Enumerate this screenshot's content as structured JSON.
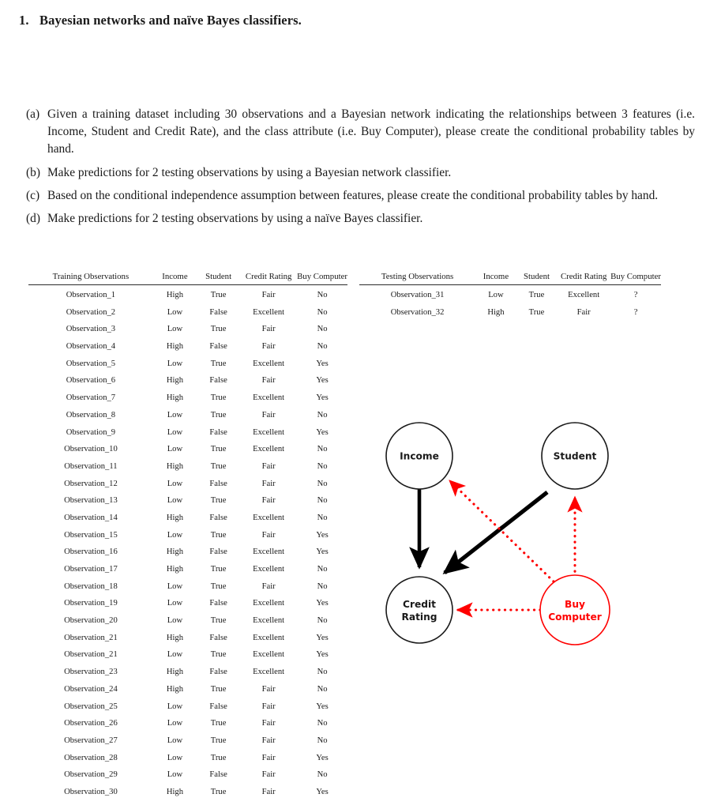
{
  "heading": {
    "number": "1.",
    "text": "Bayesian networks and naïve Bayes classifiers."
  },
  "subquestions": [
    {
      "label": "(a)",
      "text": "Given a training dataset including 30 observations and a Bayesian network indicating the relationships between 3 features (i.e. Income, Student and Credit Rate), and the class attribute (i.e. Buy Computer), please create the conditional probability tables by hand."
    },
    {
      "label": "(b)",
      "text": "Make predictions for 2 testing observations by using a Bayesian network classifier."
    },
    {
      "label": "(c)",
      "text": "Based on the conditional independence assumption between features, please create the conditional probability tables by hand."
    },
    {
      "label": "(d)",
      "text": "Make predictions for 2 testing observations by using a naïve Bayes classifier."
    }
  ],
  "training_table": {
    "headers": [
      "Training Observations",
      "Income",
      "Student",
      "Credit Rating",
      "Buy Computer"
    ],
    "rows": [
      [
        "Observation_1",
        "High",
        "True",
        "Fair",
        "No"
      ],
      [
        "Observation_2",
        "Low",
        "False",
        "Excellent",
        "No"
      ],
      [
        "Observation_3",
        "Low",
        "True",
        "Fair",
        "No"
      ],
      [
        "Observation_4",
        "High",
        "False",
        "Fair",
        "No"
      ],
      [
        "Observation_5",
        "Low",
        "True",
        "Excellent",
        "Yes"
      ],
      [
        "Observation_6",
        "High",
        "False",
        "Fair",
        "Yes"
      ],
      [
        "Observation_7",
        "High",
        "True",
        "Excellent",
        "Yes"
      ],
      [
        "Observation_8",
        "Low",
        "True",
        "Fair",
        "No"
      ],
      [
        "Observation_9",
        "Low",
        "False",
        "Excellent",
        "Yes"
      ],
      [
        "Observation_10",
        "Low",
        "True",
        "Excellent",
        "No"
      ],
      [
        "Observation_11",
        "High",
        "True",
        "Fair",
        "No"
      ],
      [
        "Observation_12",
        "Low",
        "False",
        "Fair",
        "No"
      ],
      [
        "Observation_13",
        "Low",
        "True",
        "Fair",
        "No"
      ],
      [
        "Observation_14",
        "High",
        "False",
        "Excellent",
        "No"
      ],
      [
        "Observation_15",
        "Low",
        "True",
        "Fair",
        "Yes"
      ],
      [
        "Observation_16",
        "High",
        "False",
        "Excellent",
        "Yes"
      ],
      [
        "Observation_17",
        "High",
        "True",
        "Excellent",
        "No"
      ],
      [
        "Observation_18",
        "Low",
        "True",
        "Fair",
        "No"
      ],
      [
        "Observation_19",
        "Low",
        "False",
        "Excellent",
        "Yes"
      ],
      [
        "Observation_20",
        "Low",
        "True",
        "Excellent",
        "No"
      ],
      [
        "Observation_21",
        "High",
        "False",
        "Excellent",
        "Yes"
      ],
      [
        "Observation_21",
        "Low",
        "True",
        "Excellent",
        "Yes"
      ],
      [
        "Observation_23",
        "High",
        "False",
        "Excellent",
        "No"
      ],
      [
        "Observation_24",
        "High",
        "True",
        "Fair",
        "No"
      ],
      [
        "Observation_25",
        "Low",
        "False",
        "Fair",
        "Yes"
      ],
      [
        "Observation_26",
        "Low",
        "True",
        "Fair",
        "No"
      ],
      [
        "Observation_27",
        "Low",
        "True",
        "Fair",
        "No"
      ],
      [
        "Observation_28",
        "Low",
        "True",
        "Fair",
        "Yes"
      ],
      [
        "Observation_29",
        "Low",
        "False",
        "Fair",
        "No"
      ],
      [
        "Observation_30",
        "High",
        "True",
        "Fair",
        "Yes"
      ]
    ]
  },
  "testing_table": {
    "headers": [
      "Testing Observations",
      "Income",
      "Student",
      "Credit Rating",
      "Buy Computer"
    ],
    "rows": [
      [
        "Observation_31",
        "Low",
        "True",
        "Excellent",
        "?"
      ],
      [
        "Observation_32",
        "High",
        "True",
        "Fair",
        "?"
      ]
    ]
  },
  "diagram": {
    "nodes": [
      {
        "id": "income",
        "label": "Income",
        "color": "#1a1a1a"
      },
      {
        "id": "student",
        "label": "Student",
        "color": "#1a1a1a"
      },
      {
        "id": "credit",
        "label_line1": "Credit",
        "label_line2": "Rating",
        "color": "#1a1a1a"
      },
      {
        "id": "buy-computer",
        "label_line1": "Buy",
        "label_line2": "Computer",
        "color": "#ff0000"
      }
    ],
    "edges": [
      {
        "from": "income",
        "to": "credit",
        "style": "solid",
        "color": "#000000"
      },
      {
        "from": "student",
        "to": "credit",
        "style": "solid",
        "color": "#000000"
      },
      {
        "from": "buy-computer",
        "to": "income",
        "style": "dotted",
        "color": "#ff0000"
      },
      {
        "from": "buy-computer",
        "to": "student",
        "style": "dotted",
        "color": "#ff0000"
      },
      {
        "from": "buy-computer",
        "to": "credit",
        "style": "dotted",
        "color": "#ff0000"
      }
    ],
    "colors": {
      "black": "#1a1a1a",
      "red": "#ff0000"
    }
  }
}
